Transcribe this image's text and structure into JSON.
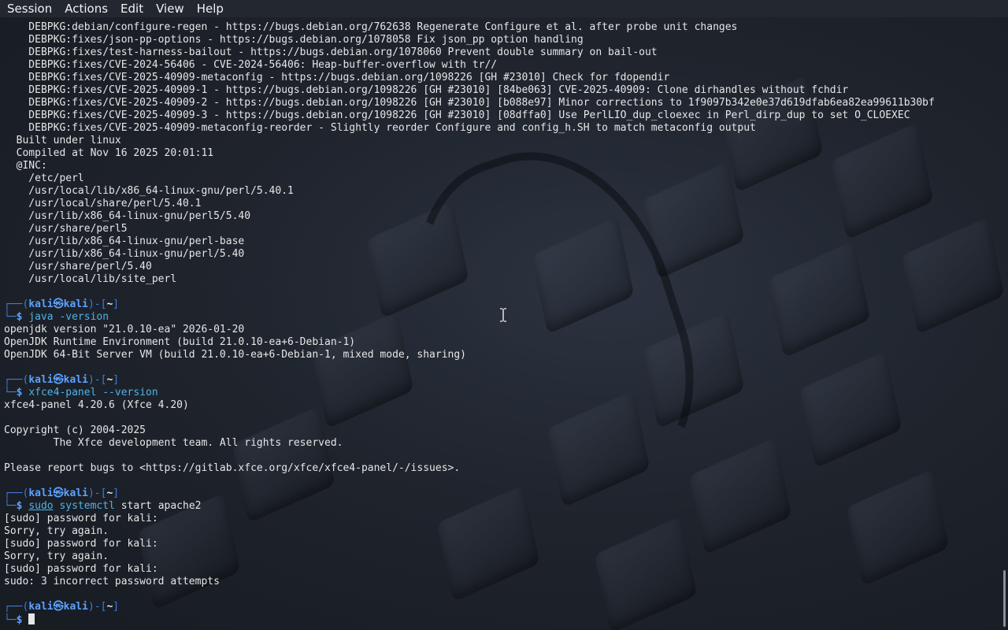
{
  "menubar": {
    "items": [
      "Session",
      "Actions",
      "Edit",
      "View",
      "Help"
    ]
  },
  "prompt": {
    "user": "kali",
    "at": "㉿",
    "host": "kali",
    "dir": "~",
    "top_prefix": "┌──(",
    "top_mid": ")-[",
    "top_suffix": "]",
    "bottom_prefix": "└─",
    "dollar": "$"
  },
  "output": {
    "perl_patches": [
      "    DEBPKG:debian/configure-regen - https://bugs.debian.org/762638 Regenerate Configure et al. after probe unit changes",
      "    DEBPKG:fixes/json-pp-options - https://bugs.debian.org/1078058 Fix json_pp option handling",
      "    DEBPKG:fixes/test-harness-bailout - https://bugs.debian.org/1078060 Prevent double summary on bail-out",
      "    DEBPKG:fixes/CVE-2024-56406 - CVE-2024-56406: Heap-buffer-overflow with tr//",
      "    DEBPKG:fixes/CVE-2025-40909-metaconfig - https://bugs.debian.org/1098226 [GH #23010] Check for fdopendir",
      "    DEBPKG:fixes/CVE-2025-40909-1 - https://bugs.debian.org/1098226 [GH #23010] [84be063] CVE-2025-40909: Clone dirhandles without fchdir",
      "    DEBPKG:fixes/CVE-2025-40909-2 - https://bugs.debian.org/1098226 [GH #23010] [b088e97] Minor corrections to 1f9097b342e0e37d619dfab6ea82ea99611b30bf",
      "    DEBPKG:fixes/CVE-2025-40909-3 - https://bugs.debian.org/1098226 [GH #23010] [08dffa0] Use PerlLIO_dup_cloexec in Perl_dirp_dup to set O_CLOEXEC",
      "    DEBPKG:fixes/CVE-2025-40909-metaconfig-reorder - Slightly reorder Configure and config_h.SH to match metaconfig output",
      "  Built under linux",
      "  Compiled at Nov 16 2025 20:01:11",
      "  @INC:",
      "    /etc/perl",
      "    /usr/local/lib/x86_64-linux-gnu/perl/5.40.1",
      "    /usr/local/share/perl/5.40.1",
      "    /usr/lib/x86_64-linux-gnu/perl5/5.40",
      "    /usr/share/perl5",
      "    /usr/lib/x86_64-linux-gnu/perl-base",
      "    /usr/lib/x86_64-linux-gnu/perl/5.40",
      "    /usr/share/perl/5.40",
      "    /usr/local/lib/site_perl"
    ],
    "java_cmd": "java -version",
    "java_output": [
      "openjdk version \"21.0.10-ea\" 2026-01-20",
      "OpenJDK Runtime Environment (build 21.0.10-ea+6-Debian-1)",
      "OpenJDK 64-Bit Server VM (build 21.0.10-ea+6-Debian-1, mixed mode, sharing)"
    ],
    "xfce_cmd": "xfce4-panel --version",
    "xfce_output": [
      "xfce4-panel 4.20.6 (Xfce 4.20)",
      "",
      "Copyright (c) 2004-2025",
      "        The Xfce development team. All rights reserved.",
      "",
      "Please report bugs to <https://gitlab.xfce.org/xfce/xfce4-panel/-/issues>."
    ],
    "sudo_cmd_word1": "sudo",
    "sudo_cmd_word2": "systemctl",
    "sudo_cmd_rest": " start apache2",
    "sudo_output": [
      "[sudo] password for kali:",
      "Sorry, try again.",
      "[sudo] password for kali:",
      "Sorry, try again.",
      "[sudo] password for kali:",
      "sudo: 3 incorrect password attempts"
    ]
  },
  "colors": {
    "prompt_frame": "#3f7bd8",
    "prompt_user": "#5aa2ff",
    "command": "#4fb3e6",
    "text": "#e6e6e6",
    "menubar_bg": "#232830"
  }
}
